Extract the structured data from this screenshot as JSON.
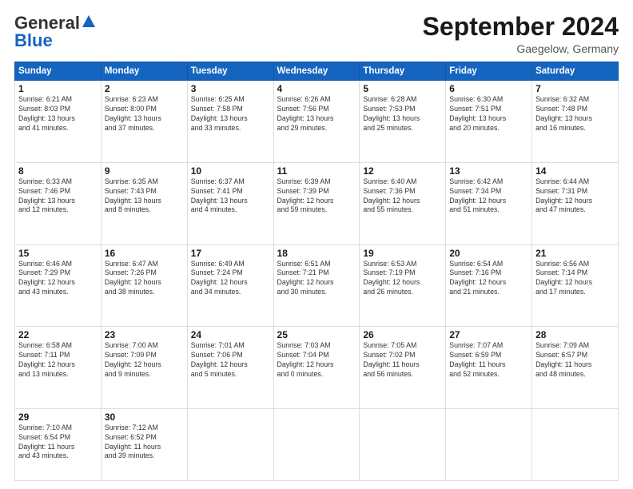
{
  "header": {
    "logo_general": "General",
    "logo_blue": "Blue",
    "month_title": "September 2024",
    "location": "Gaegelow, Germany"
  },
  "days_of_week": [
    "Sunday",
    "Monday",
    "Tuesday",
    "Wednesday",
    "Thursday",
    "Friday",
    "Saturday"
  ],
  "weeks": [
    [
      {
        "day": "1",
        "lines": [
          "Sunrise: 6:21 AM",
          "Sunset: 8:03 PM",
          "Daylight: 13 hours",
          "and 41 minutes."
        ]
      },
      {
        "day": "2",
        "lines": [
          "Sunrise: 6:23 AM",
          "Sunset: 8:00 PM",
          "Daylight: 13 hours",
          "and 37 minutes."
        ]
      },
      {
        "day": "3",
        "lines": [
          "Sunrise: 6:25 AM",
          "Sunset: 7:58 PM",
          "Daylight: 13 hours",
          "and 33 minutes."
        ]
      },
      {
        "day": "4",
        "lines": [
          "Sunrise: 6:26 AM",
          "Sunset: 7:56 PM",
          "Daylight: 13 hours",
          "and 29 minutes."
        ]
      },
      {
        "day": "5",
        "lines": [
          "Sunrise: 6:28 AM",
          "Sunset: 7:53 PM",
          "Daylight: 13 hours",
          "and 25 minutes."
        ]
      },
      {
        "day": "6",
        "lines": [
          "Sunrise: 6:30 AM",
          "Sunset: 7:51 PM",
          "Daylight: 13 hours",
          "and 20 minutes."
        ]
      },
      {
        "day": "7",
        "lines": [
          "Sunrise: 6:32 AM",
          "Sunset: 7:48 PM",
          "Daylight: 13 hours",
          "and 16 minutes."
        ]
      }
    ],
    [
      {
        "day": "8",
        "lines": [
          "Sunrise: 6:33 AM",
          "Sunset: 7:46 PM",
          "Daylight: 13 hours",
          "and 12 minutes."
        ]
      },
      {
        "day": "9",
        "lines": [
          "Sunrise: 6:35 AM",
          "Sunset: 7:43 PM",
          "Daylight: 13 hours",
          "and 8 minutes."
        ]
      },
      {
        "day": "10",
        "lines": [
          "Sunrise: 6:37 AM",
          "Sunset: 7:41 PM",
          "Daylight: 13 hours",
          "and 4 minutes."
        ]
      },
      {
        "day": "11",
        "lines": [
          "Sunrise: 6:39 AM",
          "Sunset: 7:39 PM",
          "Daylight: 12 hours",
          "and 59 minutes."
        ]
      },
      {
        "day": "12",
        "lines": [
          "Sunrise: 6:40 AM",
          "Sunset: 7:36 PM",
          "Daylight: 12 hours",
          "and 55 minutes."
        ]
      },
      {
        "day": "13",
        "lines": [
          "Sunrise: 6:42 AM",
          "Sunset: 7:34 PM",
          "Daylight: 12 hours",
          "and 51 minutes."
        ]
      },
      {
        "day": "14",
        "lines": [
          "Sunrise: 6:44 AM",
          "Sunset: 7:31 PM",
          "Daylight: 12 hours",
          "and 47 minutes."
        ]
      }
    ],
    [
      {
        "day": "15",
        "lines": [
          "Sunrise: 6:46 AM",
          "Sunset: 7:29 PM",
          "Daylight: 12 hours",
          "and 43 minutes."
        ]
      },
      {
        "day": "16",
        "lines": [
          "Sunrise: 6:47 AM",
          "Sunset: 7:26 PM",
          "Daylight: 12 hours",
          "and 38 minutes."
        ]
      },
      {
        "day": "17",
        "lines": [
          "Sunrise: 6:49 AM",
          "Sunset: 7:24 PM",
          "Daylight: 12 hours",
          "and 34 minutes."
        ]
      },
      {
        "day": "18",
        "lines": [
          "Sunrise: 6:51 AM",
          "Sunset: 7:21 PM",
          "Daylight: 12 hours",
          "and 30 minutes."
        ]
      },
      {
        "day": "19",
        "lines": [
          "Sunrise: 6:53 AM",
          "Sunset: 7:19 PM",
          "Daylight: 12 hours",
          "and 26 minutes."
        ]
      },
      {
        "day": "20",
        "lines": [
          "Sunrise: 6:54 AM",
          "Sunset: 7:16 PM",
          "Daylight: 12 hours",
          "and 21 minutes."
        ]
      },
      {
        "day": "21",
        "lines": [
          "Sunrise: 6:56 AM",
          "Sunset: 7:14 PM",
          "Daylight: 12 hours",
          "and 17 minutes."
        ]
      }
    ],
    [
      {
        "day": "22",
        "lines": [
          "Sunrise: 6:58 AM",
          "Sunset: 7:11 PM",
          "Daylight: 12 hours",
          "and 13 minutes."
        ]
      },
      {
        "day": "23",
        "lines": [
          "Sunrise: 7:00 AM",
          "Sunset: 7:09 PM",
          "Daylight: 12 hours",
          "and 9 minutes."
        ]
      },
      {
        "day": "24",
        "lines": [
          "Sunrise: 7:01 AM",
          "Sunset: 7:06 PM",
          "Daylight: 12 hours",
          "and 5 minutes."
        ]
      },
      {
        "day": "25",
        "lines": [
          "Sunrise: 7:03 AM",
          "Sunset: 7:04 PM",
          "Daylight: 12 hours",
          "and 0 minutes."
        ]
      },
      {
        "day": "26",
        "lines": [
          "Sunrise: 7:05 AM",
          "Sunset: 7:02 PM",
          "Daylight: 11 hours",
          "and 56 minutes."
        ]
      },
      {
        "day": "27",
        "lines": [
          "Sunrise: 7:07 AM",
          "Sunset: 6:59 PM",
          "Daylight: 11 hours",
          "and 52 minutes."
        ]
      },
      {
        "day": "28",
        "lines": [
          "Sunrise: 7:09 AM",
          "Sunset: 6:57 PM",
          "Daylight: 11 hours",
          "and 48 minutes."
        ]
      }
    ],
    [
      {
        "day": "29",
        "lines": [
          "Sunrise: 7:10 AM",
          "Sunset: 6:54 PM",
          "Daylight: 11 hours",
          "and 43 minutes."
        ]
      },
      {
        "day": "30",
        "lines": [
          "Sunrise: 7:12 AM",
          "Sunset: 6:52 PM",
          "Daylight: 11 hours",
          "and 39 minutes."
        ]
      },
      {
        "day": "",
        "lines": []
      },
      {
        "day": "",
        "lines": []
      },
      {
        "day": "",
        "lines": []
      },
      {
        "day": "",
        "lines": []
      },
      {
        "day": "",
        "lines": []
      }
    ]
  ]
}
